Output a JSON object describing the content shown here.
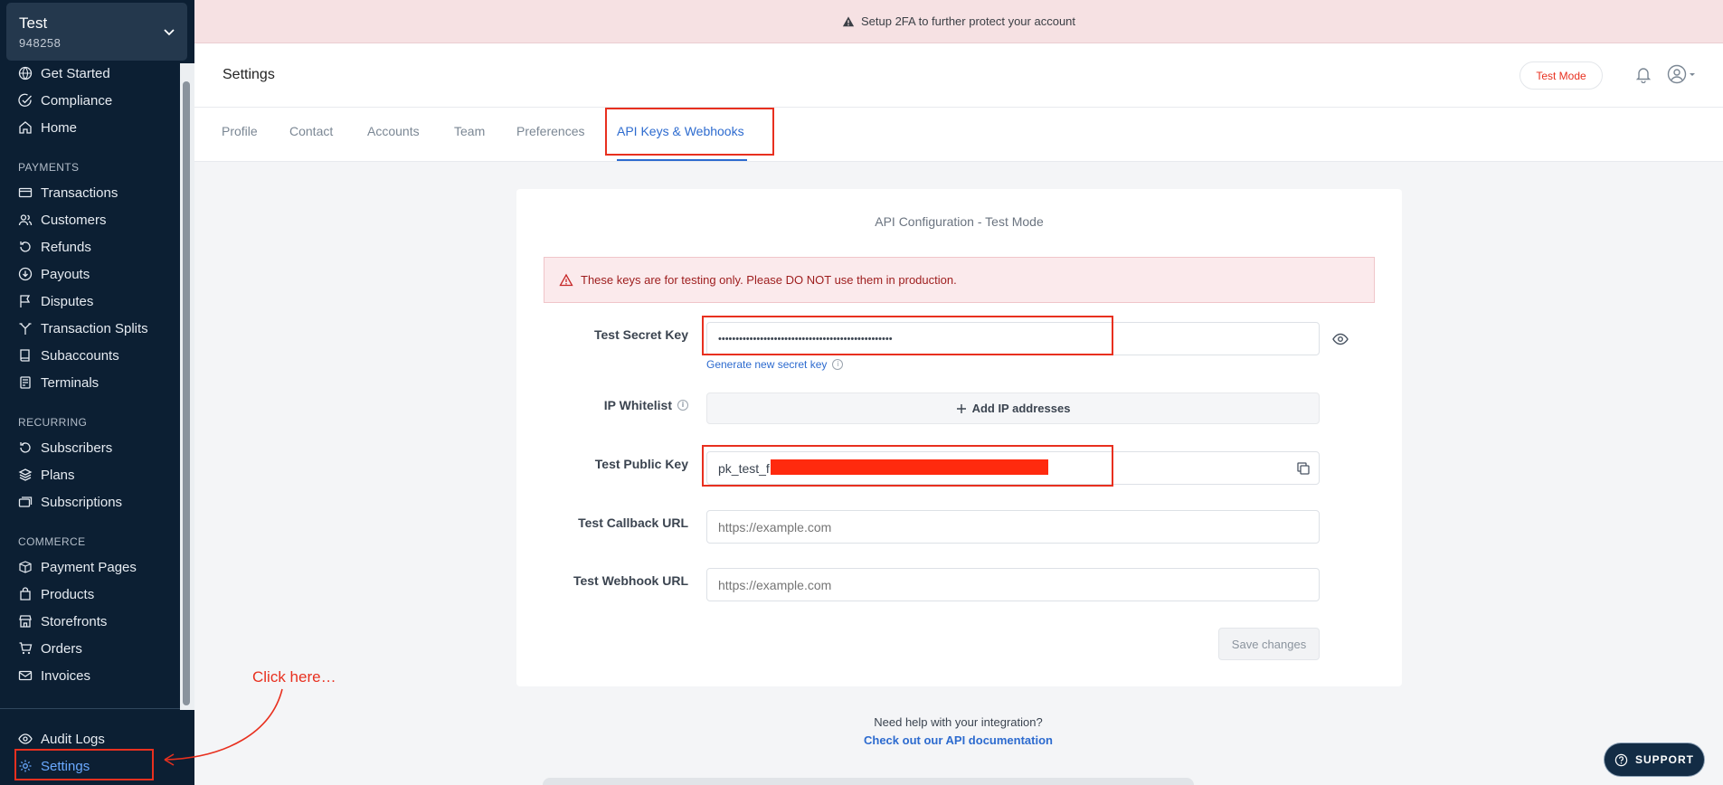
{
  "account": {
    "name": "Test",
    "id": "948258"
  },
  "sidebar": {
    "top_items": [
      {
        "label": "Get Started",
        "icon": "globe-icon"
      },
      {
        "label": "Compliance",
        "icon": "check-circle-icon"
      },
      {
        "label": "Home",
        "icon": "home-icon"
      }
    ],
    "payments_header": "PAYMENTS",
    "payments": [
      {
        "label": "Transactions",
        "icon": "card-icon"
      },
      {
        "label": "Customers",
        "icon": "users-icon"
      },
      {
        "label": "Refunds",
        "icon": "refund-icon"
      },
      {
        "label": "Payouts",
        "icon": "payout-icon"
      },
      {
        "label": "Disputes",
        "icon": "flag-icon"
      },
      {
        "label": "Transaction Splits",
        "icon": "split-icon"
      },
      {
        "label": "Subaccounts",
        "icon": "book-icon"
      },
      {
        "label": "Terminals",
        "icon": "printer-icon"
      }
    ],
    "recurring_header": "RECURRING",
    "recurring": [
      {
        "label": "Subscribers",
        "icon": "refresh-icon"
      },
      {
        "label": "Plans",
        "icon": "layers-icon"
      },
      {
        "label": "Subscriptions",
        "icon": "cards-icon"
      }
    ],
    "commerce_header": "COMMERCE",
    "commerce": [
      {
        "label": "Payment Pages",
        "icon": "box-icon"
      },
      {
        "label": "Products",
        "icon": "bag-icon"
      },
      {
        "label": "Storefronts",
        "icon": "store-icon"
      },
      {
        "label": "Orders",
        "icon": "cart-icon"
      },
      {
        "label": "Invoices",
        "icon": "mail-icon"
      }
    ],
    "bottom": [
      {
        "label": "Audit Logs",
        "icon": "eye-icon"
      },
      {
        "label": "Settings",
        "icon": "gear-icon"
      }
    ]
  },
  "banner": {
    "text": "Setup 2FA to further protect your account"
  },
  "header": {
    "title": "Settings",
    "mode": "Test Mode"
  },
  "tabs": [
    "Profile",
    "Contact",
    "Accounts",
    "Team",
    "Preferences",
    "API Keys & Webhooks"
  ],
  "active_tab": "API Keys & Webhooks",
  "card": {
    "title": "API Configuration - Test Mode",
    "alert": "These keys are for testing only. Please DO NOT use them in production.",
    "secret_key_label": "Test Secret Key",
    "secret_key_value": "••••••••••••••••••••••••••••••••••••••••••••••••••",
    "generate_link": "Generate new secret key",
    "ip_label": "IP Whitelist",
    "add_ip": "Add IP addresses",
    "public_key_label": "Test Public Key",
    "public_key_value": "pk_test_f",
    "callback_label": "Test Callback URL",
    "callback_placeholder": "https://example.com",
    "webhook_label": "Test Webhook URL",
    "webhook_placeholder": "https://example.com",
    "save": "Save changes"
  },
  "help": {
    "question": "Need help with your integration?",
    "link": "Check out our API documentation"
  },
  "support": "SUPPORT",
  "annotation": "Click here…",
  "colors": {
    "sidebar": "#0c1f33",
    "accent": "#2d6bcf",
    "highlight": "#e8301f",
    "banner": "#f6e1e3"
  }
}
